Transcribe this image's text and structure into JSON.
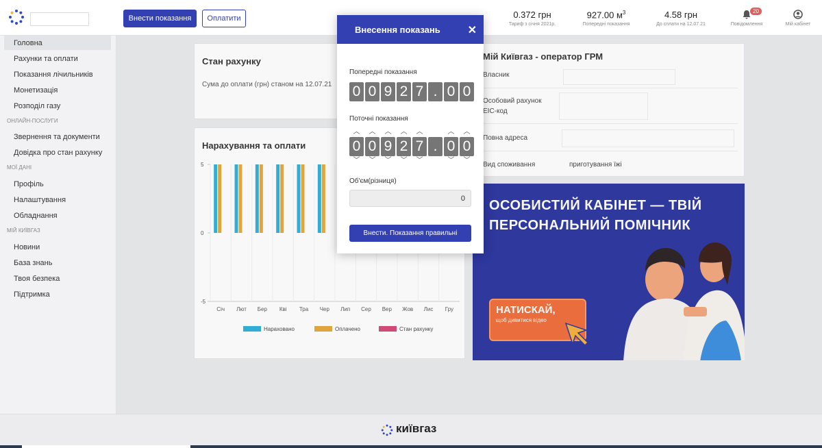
{
  "header": {
    "primary_button": "Внести показання",
    "secondary_button": "Оплатити",
    "stats": [
      {
        "value": "0.372 грн",
        "label": "Тариф з січня 2021р."
      },
      {
        "value": "927.00 м",
        "sup": "3",
        "label": "Попередні показання"
      },
      {
        "value": "4.58 грн",
        "label": "До сплати на 12.07.21"
      }
    ],
    "notifications": {
      "count": "20",
      "label": "Повідомлення"
    },
    "cabinet": {
      "label": "Мій кабінет"
    }
  },
  "sidebar": {
    "items_top": [
      "Головна",
      "Рахунки та оплати",
      "Показання лічильників",
      "Монетизація",
      "Розподіл газу"
    ],
    "section_online": "ОНЛАЙН-ПОСЛУГИ",
    "items_online": [
      "Звернення та документи",
      "Довідка про стан рахунку"
    ],
    "section_my": "МОЇ ДАНІ",
    "items_my": [
      "Профіль",
      "Налаштування",
      "Обладнання"
    ],
    "section_kyiv": "МІЙ КИЇВГАЗ",
    "items_kyiv": [
      "Новини",
      "База знань",
      "Твоя безпека",
      "Підтримка"
    ]
  },
  "account": {
    "title": "Стан рахунку",
    "line": "Сума до оплати (грн) станом на 12.07.21"
  },
  "charges": {
    "title": "Нарахування та оплати"
  },
  "chart_data": {
    "type": "bar",
    "categories": [
      "Січ",
      "Лют",
      "Бер",
      "Кві",
      "Тра",
      "Чер",
      "Лип",
      "Сер",
      "Вер",
      "Жов",
      "Лис",
      "Гру"
    ],
    "series": [
      {
        "name": "Нараховано",
        "color": "#2fb0d8",
        "values": [
          5,
          5,
          5,
          5,
          5,
          5,
          0,
          0,
          0,
          0,
          0,
          0
        ]
      },
      {
        "name": "Оплачено",
        "color": "#e5a93b",
        "values": [
          5,
          5,
          5,
          5,
          5,
          5,
          0,
          0,
          0,
          0,
          0,
          0
        ]
      },
      {
        "name": "Стан рахунку",
        "color": "#d5487a",
        "values": [
          0,
          0,
          0,
          0,
          0,
          0,
          0,
          0,
          0,
          0,
          0,
          0
        ]
      }
    ],
    "yticks": [
      "5",
      "0",
      "-5"
    ],
    "ylim": [
      -5,
      5
    ],
    "legend": "bottom"
  },
  "info": {
    "title": "Мій Київгаз - оператор ГРМ",
    "rows": [
      {
        "label": "Власник"
      },
      {
        "label1": "Особовий рахунок",
        "label2": "ЕІС-код"
      },
      {
        "label": "Повна адреса"
      },
      {
        "label": "Вид споживання",
        "value": "приготування їжі"
      }
    ]
  },
  "banner": {
    "headline": "ОСОБИСТИЙ КАБІНЕТ — ТВІЙ ПЕРСОНАЛЬНИЙ ПОМІЧНИК",
    "cta_main": "НАТИСКАЙ,",
    "cta_sub": "щоб дивитися відео",
    "colors": {
      "bg": "#2b35a0",
      "cta": "#f06d3a"
    }
  },
  "footer": {
    "brand": "київгаз"
  },
  "modal": {
    "title": "Внесення показань",
    "prev_label": "Попередні показання",
    "prev_digits": [
      "0",
      "0",
      "9",
      "2",
      "7",
      ".",
      "0",
      "0"
    ],
    "curr_label": "Поточні показання",
    "curr_digits": [
      "0",
      "0",
      "9",
      "2",
      "7",
      ".",
      "0",
      "0"
    ],
    "volume_label": "Об'єм(різниця)",
    "volume_value": "0",
    "submit": "Внести. Показання правильні"
  },
  "colors": {
    "accent": "#3340b2"
  }
}
